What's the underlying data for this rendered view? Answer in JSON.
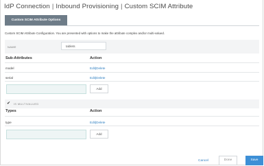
{
  "breadcrumb": {
    "items": [
      "IdP Connection",
      "Inbound Provisioning",
      "Custom SCIM Attribute"
    ],
    "separator": "|"
  },
  "tab": {
    "label": "Custom SCIM Attribute Options"
  },
  "intro_text": "Custom SCIM Attribute Configuration. You are presented with options to make the attribute complex and/or multi-valued.",
  "name_field": {
    "label": "NAME",
    "value": "tablets"
  },
  "sub_attributes": {
    "header": "Sub-Attributes",
    "action_header": "Action",
    "rows": [
      {
        "name": "model",
        "edit": "Edit",
        "sep": "|",
        "delete": "Delete"
      },
      {
        "name": "serial",
        "edit": "Edit",
        "sep": "|",
        "delete": "Delete"
      }
    ],
    "add_label": "Add"
  },
  "multivalued": {
    "checked": true,
    "check_glyph": "✔",
    "label": "IS MULTIVALUED"
  },
  "types": {
    "header": "Types",
    "action_header": "Action",
    "rows": [
      {
        "name": "type",
        "edit": "Edit",
        "sep": "|",
        "delete": "Delete"
      }
    ],
    "add_label": "Add"
  },
  "footer": {
    "cancel": "Cancel",
    "done": "Done",
    "save": "Save"
  },
  "colors": {
    "link": "#2f7fc1",
    "save": "#3d8fd6",
    "tab": "#6e7c88"
  }
}
